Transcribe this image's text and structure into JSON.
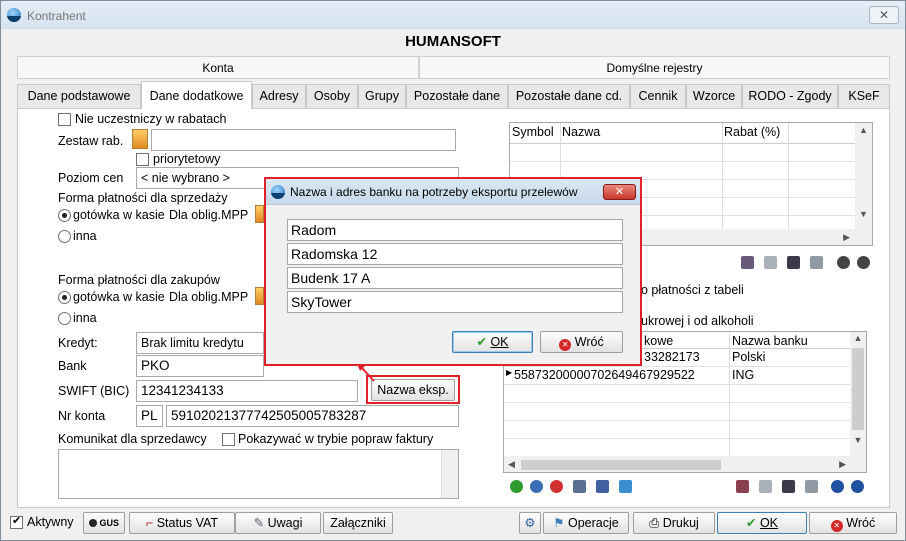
{
  "window": {
    "title": "Kontrahent",
    "heading": "HUMANSOFT"
  },
  "header_tabs": [
    "Konta",
    "Domyślne rejestry"
  ],
  "tabs": [
    "Dane podstawowe",
    "Dane dodatkowe",
    "Adresy",
    "Osoby",
    "Grupy",
    "Pozostałe dane",
    "Pozostałe dane cd.",
    "Cennik",
    "Wzorce",
    "RODO - Zgody",
    "KSeF"
  ],
  "left": {
    "nie_uczestniczy": "Nie uczestniczy w rabatach",
    "zestaw_rab": "Zestaw rab.",
    "priorytetowy": "priorytetowy",
    "poziom_cen": "Poziom cen",
    "poziom_value": "< nie wybrano >",
    "forma_sprzedazy": "Forma płatności dla sprzedaży",
    "gotowka": "gotówka w kasie",
    "dla_oblig": "Dla oblig.MPP",
    "inna": "inna",
    "forma_zakupow": "Forma płatności dla zakupów",
    "kredyt_label": "Kredyt:",
    "kredyt_value": "Brak limitu kredytu",
    "bank_label": "Bank",
    "bank_value": "PKO",
    "swift_label": "SWIFT (BIC)",
    "swift_value": "12341234133",
    "nazwa_eksp": "Nazwa eksp.",
    "nrkonta_label": "Nr konta",
    "nrkonta_prefix": "PL",
    "nrkonta_value": "59102021377742505005783287",
    "komunikat": "Komunikat dla sprzedawcy",
    "pokazywac": "Pokazywać w trybie popraw faktury"
  },
  "rabat_grid": {
    "headers": [
      "Symbol",
      "Nazwa",
      "Rabat (%)"
    ]
  },
  "right": {
    "platnosci_text": "o płatności z tabeli",
    "akcyz_text": "ukrowej i od alkoholi"
  },
  "accounts_grid": {
    "headers": [
      "kowe",
      "Nazwa banku"
    ],
    "rows": [
      {
        "account": "33282173",
        "bank": "Polski"
      },
      {
        "account": "55873200000702649467929522",
        "bank": "ING"
      }
    ]
  },
  "dialog": {
    "title": "Nazwa i adres banku na potrzeby eksportu przelewów",
    "fields": [
      "Radom",
      "Radomska 12",
      "Budenk 17 A",
      "SkyTower"
    ],
    "ok": "OK",
    "cancel": "Wróć"
  },
  "footer": {
    "aktywny": "Aktywny",
    "gus": "GUS",
    "status_vat": "Status VAT",
    "uwagi": "Uwagi",
    "zalaczniki": "Załączniki",
    "operacje": "Operacje",
    "drukuj": "Drukuj",
    "ok": "OK",
    "wroc": "Wróć"
  },
  "colors": {
    "highlight_red": "#e0202a",
    "accent_blue": "#3c7fb1"
  }
}
